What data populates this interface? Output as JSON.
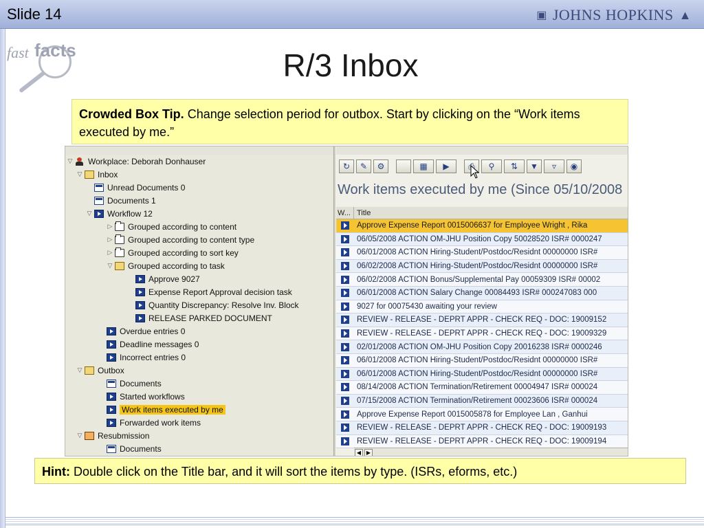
{
  "header": {
    "slide_label": "Slide 14",
    "brand": "JOHNS HOPKINS"
  },
  "logo": {
    "fast": "fast",
    "facts": "facts"
  },
  "title": "R/3 Inbox",
  "tip": {
    "bold": "Crowded Box Tip.",
    "text": " Change selection period for outbox. Start by clicking on the “Work items executed by me.”"
  },
  "hint": {
    "bold": "Hint:",
    "text": " Double click on the Title bar, and it will sort the items by type. (ISRs, eforms, etc.)"
  },
  "tree": {
    "items": [
      {
        "label": "Workplace: Deborah Donhauser",
        "icon": "person-icon"
      },
      {
        "label": "Inbox",
        "icon": "open-folder-icon"
      },
      {
        "label": "Unread Documents 0",
        "icon": "document-icon"
      },
      {
        "label": "Documents 1",
        "icon": "document-icon"
      },
      {
        "label": "Workflow 12",
        "icon": "workflow-icon"
      },
      {
        "label": "Grouped according to content",
        "icon": "folder-icon"
      },
      {
        "label": "Grouped according to content type",
        "icon": "folder-icon"
      },
      {
        "label": "Grouped according to sort key",
        "icon": "folder-icon"
      },
      {
        "label": "Grouped according to task",
        "icon": "open-folder-icon"
      },
      {
        "label": "Approve 9027",
        "icon": "workflow-icon"
      },
      {
        "label": "Expense Report Approval decision task",
        "icon": "workflow-icon"
      },
      {
        "label": "Quantity Discrepancy: Resolve Inv. Block",
        "icon": "workflow-icon"
      },
      {
        "label": "RELEASE PARKED DOCUMENT",
        "icon": "workflow-icon"
      },
      {
        "label": "Overdue entries 0",
        "icon": "workflow-icon"
      },
      {
        "label": "Deadline messages 0",
        "icon": "workflow-icon"
      },
      {
        "label": "Incorrect entries 0",
        "icon": "workflow-icon"
      },
      {
        "label": "Outbox",
        "icon": "open-folder-icon"
      },
      {
        "label": "Documents",
        "icon": "document-icon"
      },
      {
        "label": "Started workflows",
        "icon": "workflow-icon"
      },
      {
        "label": "Work items executed by me",
        "icon": "workflow-icon"
      },
      {
        "label": "Forwarded work items",
        "icon": "workflow-icon"
      },
      {
        "label": "Resubmission",
        "icon": "resubmission-icon"
      },
      {
        "label": "Documents",
        "icon": "document-icon"
      }
    ]
  },
  "right_panel": {
    "heading": "Work items executed by me (Since 05/10/2008",
    "columns": [
      "W...",
      "Title"
    ],
    "rows": [
      "Approve Expense Report 0015006637 for Employee Wright , Rika",
      "06/05/2008 ACTION OM-JHU Position Copy 50028520 ISR# 0000247",
      "06/01/2008 ACTION Hiring-Student/Postdoc/Residnt 00000000 ISR#",
      "06/02/2008 ACTION Hiring-Student/Postdoc/Residnt 00000000 ISR#",
      "06/02/2008 ACTION Bonus/Supplemental Pay 00059309 ISR# 00002",
      "06/01/2008 ACTION Salary Change 00084493 ISR# 000247083 000",
      "9027 for 00075430 awaiting your review",
      "REVIEW - RELEASE - DEPRT APPR - CHECK REQ - DOC: 19009152",
      "REVIEW - RELEASE - DEPRT APPR - CHECK REQ - DOC: 19009329",
      "02/01/2008 ACTION OM-JHU Position Copy 20016238 ISR# 0000246",
      "06/01/2008 ACTION Hiring-Student/Postdoc/Residnt 00000000 ISR#",
      "06/01/2008 ACTION Hiring-Student/Postdoc/Residnt 00000000 ISR#",
      "08/14/2008 ACTION Termination/Retirement 00004947 ISR# 000024",
      "07/15/2008 ACTION Termination/Retirement 00023606 ISR# 000024",
      "Approve Expense Report 0015005878 for Employee Lan , Ganhui",
      "REVIEW - RELEASE - DEPRT APPR - CHECK REQ - DOC: 19009193",
      "REVIEW - RELEASE - DEPRT APPR - CHECK REQ - DOC: 19009194"
    ]
  },
  "colors": {
    "header": "#9fb0d9",
    "callout": "#ffffa8",
    "selected_row": "#f6c432",
    "icon_blue": "#1f3f8a"
  }
}
